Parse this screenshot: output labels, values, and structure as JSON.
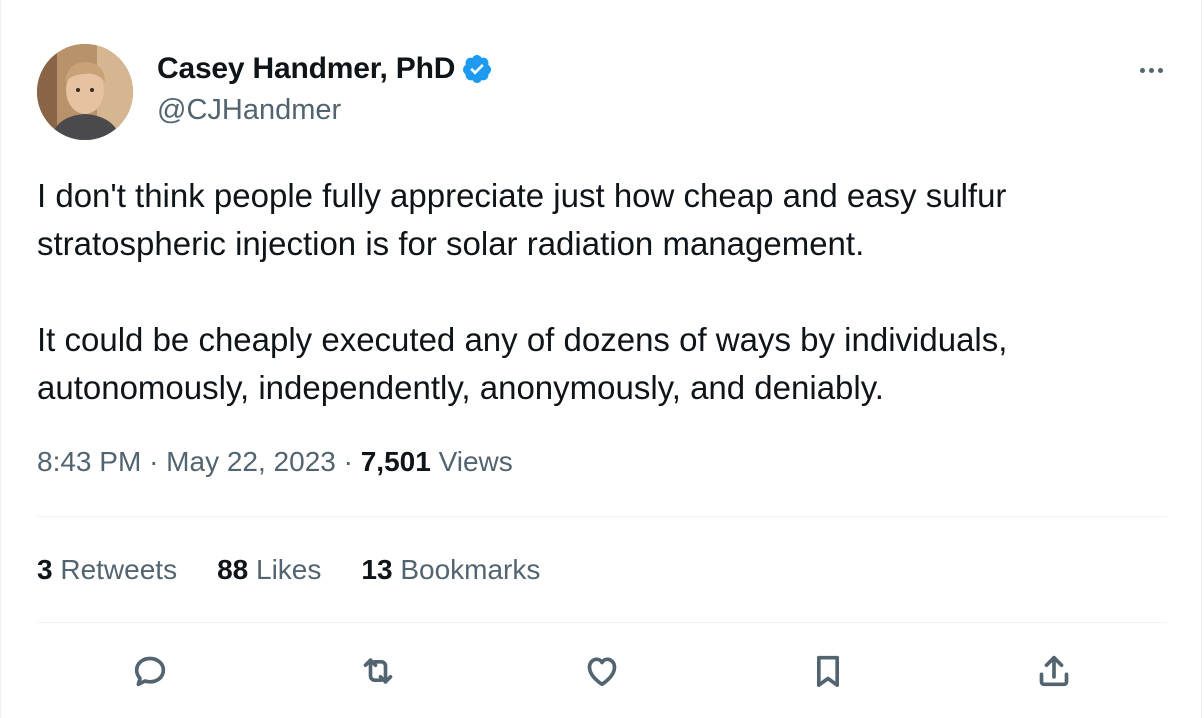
{
  "author": {
    "name": "Casey Handmer, PhD",
    "handle": "@CJHandmer",
    "verified_icon": "verified-badge-icon",
    "verified_color": "#1d9bf0"
  },
  "tweet": {
    "paragraphs": [
      "I don't think people fully appreciate just how cheap and easy sulfur stratospheric injection is for solar radiation management.",
      "It could be cheaply executed any of dozens of ways by individuals, autonomously, independently, anonymously, and deniably."
    ]
  },
  "meta": {
    "time": "8:43 PM",
    "separator": "·",
    "date": "May 22, 2023",
    "views_count": "7,501",
    "views_label": "Views"
  },
  "stats": {
    "retweets_count": "3",
    "retweets_label": "Retweets",
    "likes_count": "88",
    "likes_label": "Likes",
    "bookmarks_count": "13",
    "bookmarks_label": "Bookmarks"
  },
  "actions": [
    "reply-icon",
    "retweet-icon",
    "like-icon",
    "bookmark-icon",
    "share-icon"
  ],
  "colors": {
    "text": "#0f1419",
    "secondary": "#536471",
    "divider": "#eff3f4"
  }
}
